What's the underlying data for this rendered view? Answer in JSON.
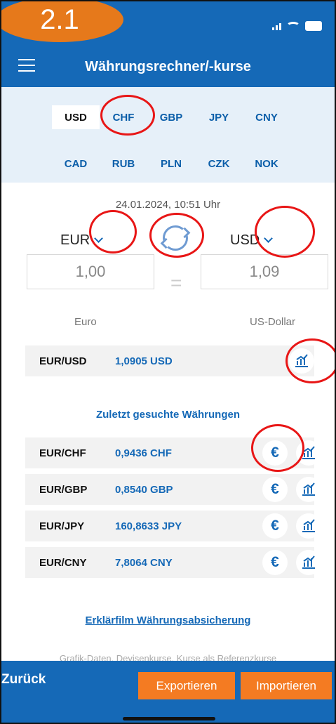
{
  "badge": "2.1",
  "header": {
    "title": "Währungsrechner/-kurse"
  },
  "currencies": [
    "USD",
    "CHF",
    "GBP",
    "JPY",
    "CNY",
    "CAD",
    "RUB",
    "PLN",
    "CZK",
    "NOK"
  ],
  "converter": {
    "timestamp": "24.01.2024, 10:51 Uhr",
    "from_currency": "EUR",
    "to_currency": "USD",
    "from_amount": "1,00",
    "equals": "=",
    "to_amount": "1,09",
    "from_name": "Euro",
    "to_name": "US-Dollar"
  },
  "main_rate": {
    "pair": "EUR/USD",
    "value": "1,0905 USD"
  },
  "recent_title": "Zuletzt gesuchte Währungen",
  "recent_rates": [
    {
      "pair": "EUR/CHF",
      "value": "0,9436 CHF"
    },
    {
      "pair": "EUR/GBP",
      "value": "0,8540 GBP"
    },
    {
      "pair": "EUR/JPY",
      "value": "160,8633 JPY"
    },
    {
      "pair": "EUR/CNY",
      "value": "7,8064 CNY"
    }
  ],
  "icon_names": [
    "menu-icon",
    "swap-icon",
    "euro-exchange-icon",
    "chart-icon",
    "signal-icon",
    "wifi-icon",
    "battery-icon"
  ],
  "links": {
    "video": "Erklärfilm Währungsabsicherung"
  },
  "faded_text": "Grafik-Daten. Devisenkurse, Kurse als Referenzkurse",
  "footer": {
    "back": "Zurück",
    "export": "Exportieren",
    "import": "Importieren"
  },
  "colors": {
    "primary": "#1569b7",
    "orange": "#f47b22",
    "annotation": "#e81616"
  }
}
